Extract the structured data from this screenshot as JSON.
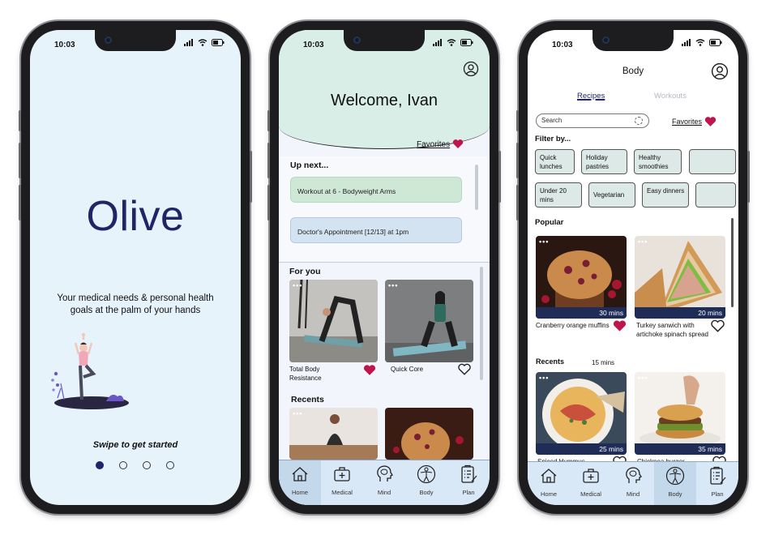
{
  "status_time": "10:03",
  "screen1": {
    "logo": "Olive",
    "tagline": "Your medical needs & personal health goals at the palm of your hands",
    "swipe_label": "Swipe to get started",
    "page_indicator": {
      "count": 4,
      "active_index": 0
    }
  },
  "screen2": {
    "welcome": "Welcome, Ivan",
    "favorites_label": "Favorites",
    "upnext_title": "Up next...",
    "upnext_items": [
      {
        "label": "Workout at 6 - Bodyweight Arms"
      },
      {
        "label": "Doctor's Appointment [12/13] at 1pm"
      }
    ],
    "foryou_title": "For you",
    "foryou_cards": [
      {
        "caption": "Total Body Resistance",
        "favorited": true,
        "badge": "•••"
      },
      {
        "caption": "Quick Core",
        "favorited": false,
        "badge": "•••"
      }
    ],
    "recents_title": "Recents",
    "recent_badge": "•••"
  },
  "screen3": {
    "title": "Body",
    "tabs": {
      "recipes": "Recipes",
      "workouts": "Workouts",
      "active": "recipes"
    },
    "search_placeholder": "Search",
    "favorites_label": "Favorites",
    "filter_label": "Filter by...",
    "chips_row1": [
      "Quick lunches",
      "Holiday pastries",
      "Healthy smoothies",
      ""
    ],
    "chips_row2": [
      "Under 20 mins",
      "Vegetarian",
      "Easy dinners",
      ""
    ],
    "popular_title": "Popular",
    "popular": [
      {
        "name": "Cranberry orange muffins",
        "time": "30 mins",
        "favorited": true,
        "badge": "•••"
      },
      {
        "name": "Turkey sanwich with artichoke spinach spread",
        "time": "20 mins",
        "favorited": false,
        "badge": "•••"
      }
    ],
    "recents_title": "Recents",
    "recents_filter": "15 mins",
    "recents": [
      {
        "name": "Spiced Hummus",
        "time": "25 mins",
        "favorited": false,
        "badge": "•••"
      },
      {
        "name": "Chickpea burger",
        "time": "35 mins",
        "favorited": false,
        "badge": "•••"
      }
    ]
  },
  "nav": {
    "items": [
      {
        "label": "Home",
        "icon": "home-icon"
      },
      {
        "label": "Medical",
        "icon": "medical-kit-icon"
      },
      {
        "label": "Mind",
        "icon": "brain-head-icon"
      },
      {
        "label": "Body",
        "icon": "body-figure-icon"
      },
      {
        "label": "Plan",
        "icon": "clipboard-icon"
      }
    ],
    "screen2_active": "Home",
    "screen3_active": "Body"
  },
  "colors": {
    "brand_navy": "#1f2566",
    "heart_red": "#c0144c",
    "welcome_bg": "#d8eee6",
    "nav_bg": "#d9e8f6",
    "screen1_bg": "#e7f3fb"
  }
}
